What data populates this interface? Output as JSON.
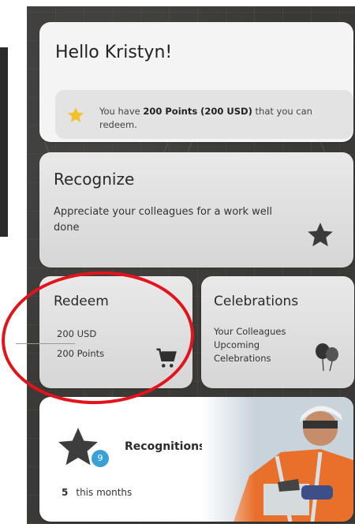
{
  "greeting": "Hello Kristyn!",
  "points": {
    "prefix": "You have ",
    "bold": "200 Points (200 USD)",
    "suffix": " that you can redeem."
  },
  "recognize": {
    "title": "Recognize",
    "description": "Appreciate your colleagues for a work well done"
  },
  "redeem": {
    "title": "Redeem",
    "usd": "200 USD",
    "points": "200 Points"
  },
  "celebrations": {
    "title": "Celebrations",
    "description": "Your Colleagues Upcoming Celebrations"
  },
  "recognitions": {
    "title": "Recognitions experienced",
    "badge_count": "9",
    "month_count": "5",
    "month_label": "this months"
  },
  "colors": {
    "star_gold": "#f2c22b",
    "badge_blue": "#3aa0d8",
    "highlight_red": "#e3131b"
  }
}
